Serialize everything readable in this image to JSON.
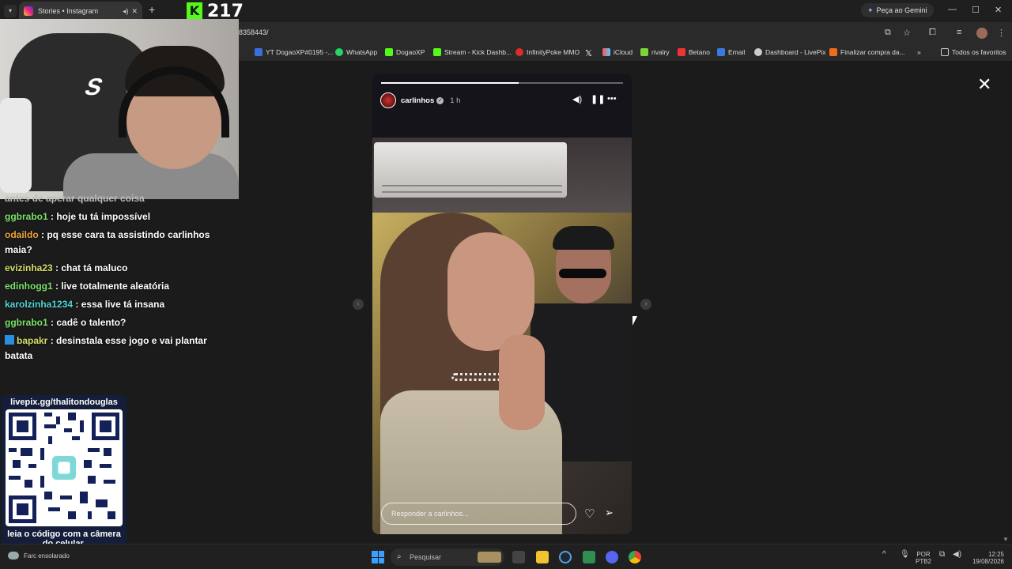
{
  "browser": {
    "tab_title": "Stories • Instagram",
    "tab_menu_icon": "chevron-down-icon",
    "new_tab": "+",
    "tab_close": "✕",
    "url_fragment": "8358443/",
    "gemini_label": "Peça ao Gemini",
    "window_controls": [
      "—",
      "☐",
      "✕"
    ]
  },
  "kick_overlay": {
    "viewer_count": "217",
    "logo_letter": "K"
  },
  "bookmarks": [
    "YT DogaoXP#0195 -...",
    "WhatsApp",
    "DogaoXP",
    "Stream - Kick Dashb...",
    "InfinityPoke MMO",
    "",
    "iCloud",
    "rivalry",
    "Betano",
    "Email",
    "Dashboard - LivePix",
    "Finalizar compra da..."
  ],
  "bookmarks_more": "»",
  "bookmarks_all": "Todos os favoritos",
  "chat": {
    "cut_line": "antes de aperar qualquer coisa",
    "messages": [
      {
        "user": "ggbrabo1",
        "color": "#7de36b",
        "text": ": hoje tu tá impossível"
      },
      {
        "user": "odaildo",
        "color": "#f0a43a",
        "text": ": pq esse cara ta assistindo carlinhos maia?"
      },
      {
        "user": "evizinha23",
        "color": "#d6e06a",
        "text": ": chat tá maluco"
      },
      {
        "user": "edinhogg1",
        "color": "#7de36b",
        "text": ": live totalmente aleatória"
      },
      {
        "user": "karolzinha1234",
        "color": "#54d6d6",
        "text": ": essa live tá insana"
      },
      {
        "user": "ggbrabo1",
        "color": "#7de36b",
        "text": ": cadê o talento?"
      },
      {
        "user": "bapakr",
        "color": "#d6e06a",
        "text": ": desinstala esse jogo e vai plantar batata"
      }
    ]
  },
  "livepix": {
    "url": "livepix.gg/thalitondouglas",
    "footer": "leia o código com a câmera do celular."
  },
  "story": {
    "username": "carlinhos",
    "time": "1 h",
    "reply_placeholder": "Responder a carlinhos...",
    "progress": 0.57
  },
  "taskbar": {
    "weather": "Farc ensolarado",
    "search_placeholder": "Pesquisar",
    "lang_top": "POR",
    "lang_bottom": "PTB2",
    "time": "12:25",
    "date": "19/08/2026"
  }
}
